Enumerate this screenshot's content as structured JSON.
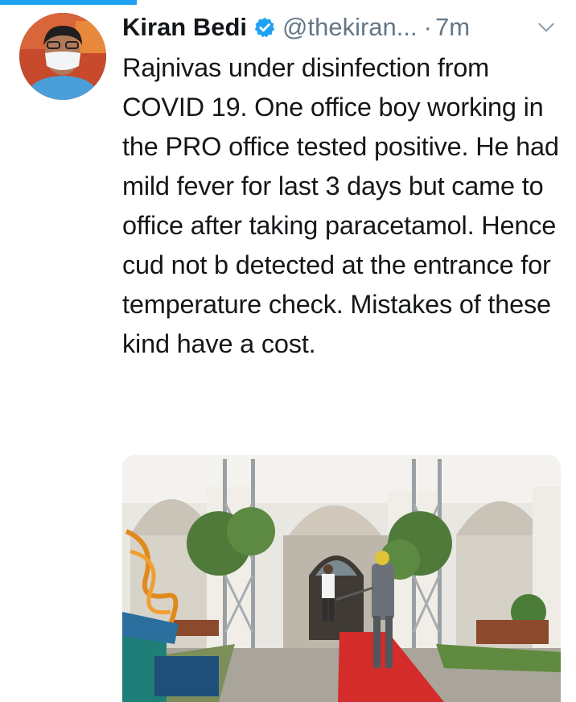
{
  "tweet": {
    "author": {
      "display_name": "Kiran Bedi",
      "handle": "@thekiran...",
      "verified": true,
      "avatar_icon": "avatar-photo"
    },
    "separator": "·",
    "timestamp": "7m",
    "menu_icon": "chevron-down-icon",
    "text": "Rajnivas under disinfection from COVID 19. One office boy working in the PRO office tested positive. He had mild fever for last 3 days but came to office after taking paracetamol. Hence cud not b detected at the entrance for temperature check. Mistakes of these kind have a cost.",
    "media": {
      "type": "photo",
      "icon": "photo-courtyard-disinfection"
    }
  },
  "colors": {
    "accent": "#1da1f2",
    "muted": "#657786",
    "text": "#14171a"
  }
}
